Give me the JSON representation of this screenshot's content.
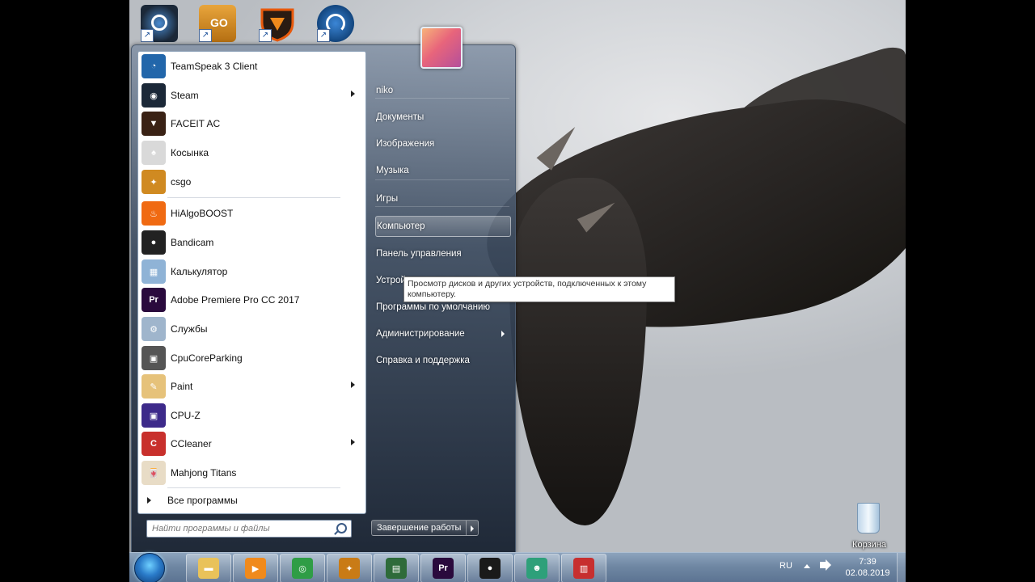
{
  "desktop": {
    "shortcuts": [
      {
        "name": "steam-shortcut",
        "icon": "steam-icon",
        "color": "#1b2838"
      },
      {
        "name": "csgo-shortcut",
        "icon": "csgo-icon",
        "color": "#d08a21",
        "text": "GO"
      },
      {
        "name": "faceit-shortcut",
        "icon": "faceit-shield-icon",
        "color": "#e8590c"
      },
      {
        "name": "teamspeak-shortcut",
        "icon": "teamspeak-icon",
        "color": "#1b5fa3"
      }
    ],
    "recycle_bin": {
      "label": "Корзина",
      "icon": "recycle-bin-icon"
    }
  },
  "start_menu": {
    "programs": [
      {
        "label": "TeamSpeak 3 Client",
        "icon": "teamspeak-icon",
        "color": "#2266aa",
        "glyph": "◔",
        "submenu": false
      },
      {
        "label": "Steam",
        "icon": "steam-icon",
        "color": "#1b2838",
        "glyph": "◉",
        "submenu": true
      },
      {
        "label": "FACEIT AC",
        "icon": "faceit-shield-icon",
        "color": "#3a2215",
        "glyph": "▼",
        "submenu": false
      },
      {
        "label": "Косынка",
        "icon": "solitaire-cards-icon",
        "color": "#d9d9d9",
        "glyph": "♠",
        "submenu": false
      },
      {
        "label": "csgo",
        "icon": "csgo-icon",
        "color": "#d08a21",
        "glyph": "✦",
        "submenu": false
      },
      {
        "label": "HiAlgoBOOST",
        "icon": "flame-icon",
        "color": "#f06a12",
        "glyph": "♨",
        "submenu": false
      },
      {
        "label": "Bandicam",
        "icon": "bandicam-record-icon",
        "color": "#222222",
        "glyph": "●",
        "submenu": false
      },
      {
        "label": "Калькулятор",
        "icon": "calculator-icon",
        "color": "#8fb3d6",
        "glyph": "▦",
        "submenu": false
      },
      {
        "label": "Adobe Premiere Pro CC 2017",
        "icon": "premiere-icon",
        "color": "#2a0a3d",
        "glyph": "Pr",
        "submenu": false
      },
      {
        "label": "Службы",
        "icon": "gears-icon",
        "color": "#9fb5cc",
        "glyph": "⚙",
        "submenu": false
      },
      {
        "label": "CpuCoreParking",
        "icon": "cpu-chip-icon",
        "color": "#555555",
        "glyph": "▣",
        "submenu": false
      },
      {
        "label": "Paint",
        "icon": "paint-palette-icon",
        "color": "#e6c27a",
        "glyph": "✎",
        "submenu": true
      },
      {
        "label": "CPU-Z",
        "icon": "cpuz-icon",
        "color": "#3d2a8a",
        "glyph": "▣",
        "submenu": false
      },
      {
        "label": "CCleaner",
        "icon": "ccleaner-icon",
        "color": "#c8302c",
        "glyph": "C",
        "submenu": true
      },
      {
        "label": "Mahjong Titans",
        "icon": "mahjong-tile-icon",
        "color": "#e8dcc6",
        "glyph": "🀄",
        "submenu": false
      }
    ],
    "all_programs_label": "Все программы",
    "search_placeholder": "Найти программы и файлы",
    "right_links": [
      {
        "label": "niko",
        "submenu": false
      },
      {
        "label": "Документы",
        "submenu": false
      },
      {
        "label": "Изображения",
        "submenu": false
      },
      {
        "label": "Музыка",
        "submenu": false
      },
      {
        "label": "Игры",
        "submenu": false
      },
      {
        "label": "Компьютер",
        "submenu": false,
        "hover": true
      },
      {
        "label": "Панель управления",
        "submenu": false
      },
      {
        "label": "Устройства и принтеры",
        "submenu": false
      },
      {
        "label": "Программы по умолчанию",
        "submenu": false
      },
      {
        "label": "Администрирование",
        "submenu": true
      },
      {
        "label": "Справка и поддержка",
        "submenu": false
      }
    ],
    "shutdown_label": "Завершение работы",
    "tooltip": "Просмотр дисков и других устройств, подключенных к этому компьютеру."
  },
  "taskbar": {
    "start_icon": "windows-start-orb-icon",
    "pinned": [
      {
        "name": "taskbar-explorer",
        "icon": "folder-icon",
        "color": "#e9c25a",
        "glyph": "▬"
      },
      {
        "name": "taskbar-media-player",
        "icon": "media-player-icon",
        "color": "#f08a1c",
        "glyph": "▶"
      },
      {
        "name": "taskbar-chrome",
        "icon": "chrome-icon",
        "color": "#2f9d46",
        "glyph": "◎"
      },
      {
        "name": "taskbar-csgo",
        "icon": "csgo-icon",
        "color": "#c97b16",
        "glyph": "✦"
      },
      {
        "name": "taskbar-cpu-monitor",
        "icon": "monitor-icon",
        "color": "#2e6b3a",
        "glyph": "▤"
      },
      {
        "name": "taskbar-premiere",
        "icon": "premiere-icon",
        "color": "#2a0a3d",
        "glyph": "Pr"
      },
      {
        "name": "taskbar-bandicam",
        "icon": "bandicam-record-icon",
        "color": "#1a1a1a",
        "glyph": "●"
      },
      {
        "name": "taskbar-discord",
        "icon": "gamepad-icon",
        "color": "#2ea07a",
        "glyph": "☻"
      },
      {
        "name": "taskbar-toolbox",
        "icon": "toolbox-icon",
        "color": "#c72f2f",
        "glyph": "▥"
      }
    ],
    "language": "RU",
    "time": "7:39",
    "date": "02.08.2019"
  }
}
